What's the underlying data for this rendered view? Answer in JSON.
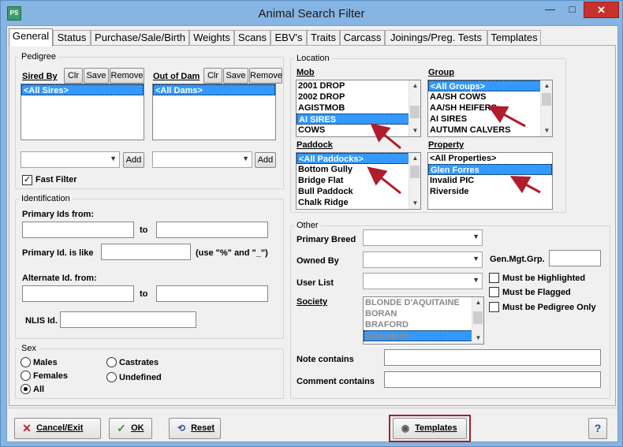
{
  "window": {
    "title": "Animal Search Filter",
    "app_icon_text": "PS",
    "minimize": "—",
    "maximize": "□",
    "close": "✕"
  },
  "tabs": [
    "General",
    "Status",
    "Purchase/Sale/Birth",
    "Weights",
    "Scans",
    "EBV's",
    "Traits",
    "Carcass",
    "Joinings/Preg. Tests",
    "Templates"
  ],
  "pedigree": {
    "legend": "Pedigree",
    "sired_by_label": "Sired By",
    "out_of_dam_label": "Out of Dam",
    "clr": "Clr",
    "save": "Save",
    "remove": "Remove",
    "add": "Add",
    "sires": [
      "<All Sires>"
    ],
    "dams": [
      "<All Dams>"
    ],
    "fast_filter": "Fast Filter",
    "fast_filter_checked": true
  },
  "identification": {
    "legend": "Identification",
    "primary_ids_from": "Primary Ids from:",
    "to": "to",
    "primary_like": "Primary Id. is like",
    "like_hint": "(use \"%\" and \"_\")",
    "alternate_from": "Alternate Id. from:",
    "nlis": "NLIS Id."
  },
  "sex": {
    "legend": "Sex",
    "options": [
      "Males",
      "Castrates",
      "Females",
      "Undefined",
      "All"
    ],
    "selected": "All"
  },
  "location": {
    "legend": "Location",
    "mob_label": "Mob",
    "mob": [
      "2001 DROP",
      "2002 DROP",
      "AGISTMOB",
      "AI SIRES",
      "COWS"
    ],
    "mob_selected": "AI SIRES",
    "group_label": "Group",
    "group": [
      "<All Groups>",
      "AA/SH COWS",
      "AA/SH HEIFERS",
      "AI SIRES",
      "AUTUMN CALVERS"
    ],
    "group_selected": "<All Groups>",
    "paddock_label": "Paddock",
    "paddock": [
      "<All Paddocks>",
      "Bottom Gully",
      "Bridge Flat",
      "Bull Paddock",
      "Chalk Ridge"
    ],
    "paddock_selected": "<All Paddocks>",
    "property_label": "Property",
    "property": [
      "<All Properties>",
      "Glen Forres",
      "Invalid PIC",
      "Riverside"
    ],
    "property_selected": "Glen Forres"
  },
  "other": {
    "legend": "Other",
    "primary_breed": "Primary Breed",
    "owned_by": "Owned By",
    "user_list": "User List",
    "society": "Society",
    "gen_mgt_grp": "Gen.Mgt.Grp.",
    "must_highlighted": "Must be Highlighted",
    "must_flagged": "Must be Flagged",
    "must_pedigree": "Must be Pedigree Only",
    "society_list": [
      "BLONDE D'AQUITAINE",
      "BORAN",
      "BRAFORD",
      "BRAHMAN"
    ],
    "society_selected": "BRAHMAN",
    "note_contains": "Note contains",
    "comment_contains": "Comment contains"
  },
  "buttons": {
    "cancel": "Cancel/Exit",
    "ok": "OK",
    "reset": "Reset",
    "templates": "Templates",
    "help": "?"
  },
  "colors": {
    "selection": "#3399ff",
    "annotation": "#b01c2a"
  }
}
